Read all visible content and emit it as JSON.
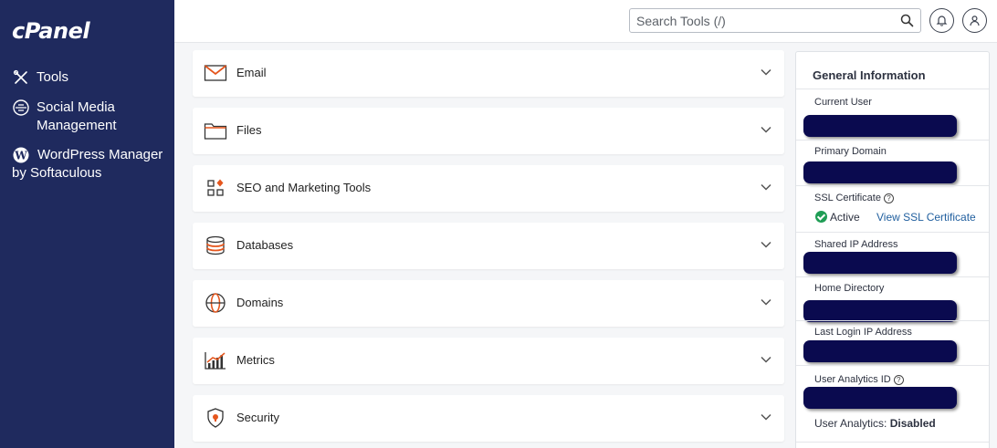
{
  "sidebar": {
    "logo": "cPanel",
    "items": [
      {
        "label": "Tools",
        "icon": "tools-icon"
      },
      {
        "label": "Social Media Management",
        "icon": "social-media-icon"
      },
      {
        "label": "WordPress Manager by Softaculous",
        "icon": "wordpress-icon"
      }
    ]
  },
  "header": {
    "search_placeholder": "Search Tools (/)",
    "search_icon": "search-icon",
    "notifications_icon": "bell-icon",
    "user_icon": "user-icon"
  },
  "categories": [
    {
      "label": "Email",
      "icon": "email-icon"
    },
    {
      "label": "Files",
      "icon": "folder-icon"
    },
    {
      "label": "SEO and Marketing Tools",
      "icon": "seo-icon"
    },
    {
      "label": "Databases",
      "icon": "database-icon"
    },
    {
      "label": "Domains",
      "icon": "globe-icon"
    },
    {
      "label": "Metrics",
      "icon": "metrics-icon"
    },
    {
      "label": "Security",
      "icon": "security-icon"
    }
  ],
  "general_info": {
    "title": "General Information",
    "current_user_label": "Current User",
    "primary_domain_label": "Primary Domain",
    "ssl_label": "SSL Certificate",
    "ssl_status": "Active",
    "ssl_link": "View SSL Certificate",
    "shared_ip_label": "Shared IP Address",
    "home_dir_label": "Home Directory",
    "last_login_label": "Last Login IP Address",
    "analytics_id_label": "User Analytics ID",
    "analytics_label": "User Analytics:",
    "analytics_value": "Disabled"
  },
  "colors": {
    "sidebar_bg": "#1f2a5e",
    "accent_orange": "#e5561d",
    "redaction": "#0a0a4f",
    "ssl_active": "#1f9d55",
    "link": "#1f5e9e"
  }
}
